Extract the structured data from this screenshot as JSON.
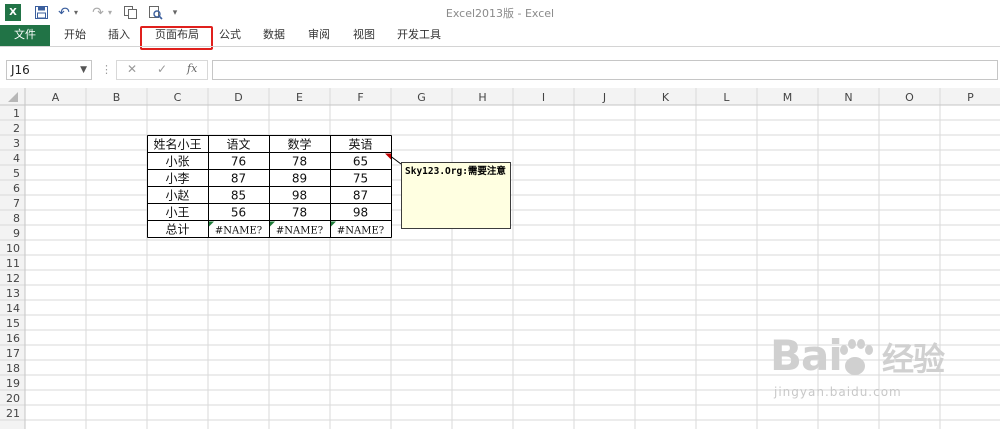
{
  "window": {
    "title": "Excel2013版 - Excel"
  },
  "quick_access": {
    "save_icon": "save-icon",
    "undo_icon": "undo-icon",
    "redo_icon": "redo-icon"
  },
  "ribbon": {
    "tabs": [
      "文件",
      "开始",
      "插入",
      "页面布局",
      "公式",
      "数据",
      "审阅",
      "视图",
      "开发工具"
    ],
    "file_color": "#217346",
    "highlight_color": "#e0201d"
  },
  "formula_bar": {
    "name_box": "J16",
    "fx": "fx",
    "cancel": "✕",
    "enter": "✓",
    "value": ""
  },
  "sheet": {
    "columns": [
      "A",
      "B",
      "C",
      "D",
      "E",
      "F",
      "G",
      "H",
      "I",
      "J",
      "K",
      "L",
      "M",
      "N",
      "O",
      "P"
    ],
    "rows": [
      "1",
      "2",
      "3",
      "4",
      "5",
      "6",
      "7",
      "8",
      "9",
      "10",
      "11",
      "12",
      "13",
      "14",
      "15",
      "16",
      "17",
      "18",
      "19",
      "20",
      "21"
    ],
    "table_header": [
      "姓名小王",
      "语文",
      "数学",
      "英语"
    ],
    "table_rows": [
      [
        "小张",
        "76",
        "78",
        "65"
      ],
      [
        "小李",
        "87",
        "89",
        "75"
      ],
      [
        "小赵",
        "85",
        "98",
        "87"
      ],
      [
        "小王",
        "56",
        "78",
        "98"
      ],
      [
        "总计",
        "#NAME?",
        "#NAME?",
        "#NAME?"
      ]
    ],
    "comment_text": "Sky123.Org:需要注意"
  },
  "watermark": {
    "logo": "Bai 经验",
    "url": "jingyan.baidu.com"
  }
}
